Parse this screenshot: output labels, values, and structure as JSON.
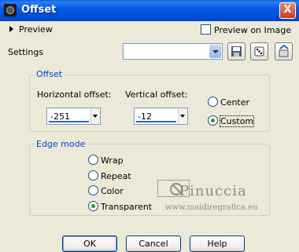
{
  "window": {
    "title": "Offset",
    "close_glyph": "X"
  },
  "preview": {
    "toggle_label": "Preview",
    "preview_on_image_label": "Preview on Image",
    "preview_on_image_checked": false
  },
  "settings": {
    "label": "Settings",
    "value": ""
  },
  "offset": {
    "group_label": "Offset",
    "horizontal_label": "Horizontal offset:",
    "horizontal_value": "-251",
    "vertical_label": "Vertical offset:",
    "vertical_value": "-12",
    "center_label": "Center",
    "custom_label": "Custom",
    "selected": "custom"
  },
  "edge_mode": {
    "group_label": "Edge mode",
    "options": [
      "Wrap",
      "Repeat",
      "Color",
      "Transparent"
    ],
    "selected": "Transparent"
  },
  "watermark": {
    "name": "Pinuccia",
    "url": "www.maidiregrafica.eu"
  },
  "buttons": {
    "ok": "OK",
    "cancel": "Cancel",
    "help": "Help"
  },
  "colors": {
    "title_bar": "#0058e6",
    "group_title": "#0046d5",
    "radio_selected": "#21a121"
  }
}
